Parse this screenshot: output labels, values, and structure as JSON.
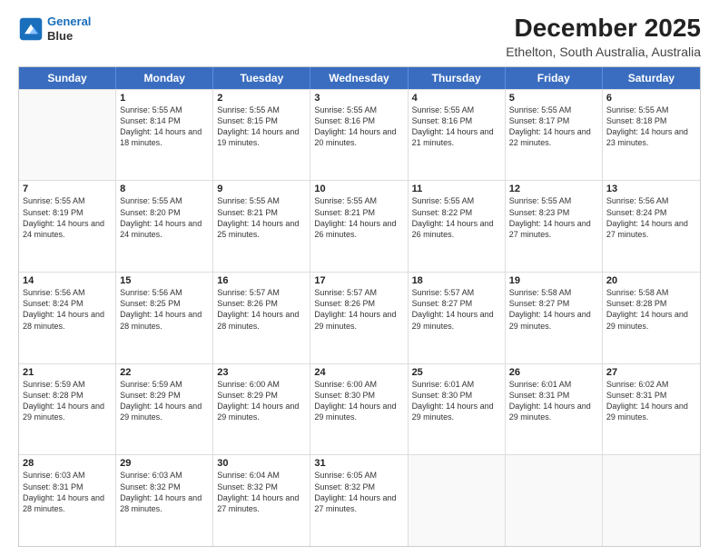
{
  "header": {
    "logo_line1": "General",
    "logo_line2": "Blue",
    "main_title": "December 2025",
    "sub_title": "Ethelton, South Australia, Australia"
  },
  "days_of_week": [
    "Sunday",
    "Monday",
    "Tuesday",
    "Wednesday",
    "Thursday",
    "Friday",
    "Saturday"
  ],
  "weeks": [
    [
      {
        "day": "",
        "sunrise": "",
        "sunset": "",
        "daylight": ""
      },
      {
        "day": "1",
        "sunrise": "Sunrise: 5:55 AM",
        "sunset": "Sunset: 8:14 PM",
        "daylight": "Daylight: 14 hours and 18 minutes."
      },
      {
        "day": "2",
        "sunrise": "Sunrise: 5:55 AM",
        "sunset": "Sunset: 8:15 PM",
        "daylight": "Daylight: 14 hours and 19 minutes."
      },
      {
        "day": "3",
        "sunrise": "Sunrise: 5:55 AM",
        "sunset": "Sunset: 8:16 PM",
        "daylight": "Daylight: 14 hours and 20 minutes."
      },
      {
        "day": "4",
        "sunrise": "Sunrise: 5:55 AM",
        "sunset": "Sunset: 8:16 PM",
        "daylight": "Daylight: 14 hours and 21 minutes."
      },
      {
        "day": "5",
        "sunrise": "Sunrise: 5:55 AM",
        "sunset": "Sunset: 8:17 PM",
        "daylight": "Daylight: 14 hours and 22 minutes."
      },
      {
        "day": "6",
        "sunrise": "Sunrise: 5:55 AM",
        "sunset": "Sunset: 8:18 PM",
        "daylight": "Daylight: 14 hours and 23 minutes."
      }
    ],
    [
      {
        "day": "7",
        "sunrise": "Sunrise: 5:55 AM",
        "sunset": "Sunset: 8:19 PM",
        "daylight": "Daylight: 14 hours and 24 minutes."
      },
      {
        "day": "8",
        "sunrise": "Sunrise: 5:55 AM",
        "sunset": "Sunset: 8:20 PM",
        "daylight": "Daylight: 14 hours and 24 minutes."
      },
      {
        "day": "9",
        "sunrise": "Sunrise: 5:55 AM",
        "sunset": "Sunset: 8:21 PM",
        "daylight": "Daylight: 14 hours and 25 minutes."
      },
      {
        "day": "10",
        "sunrise": "Sunrise: 5:55 AM",
        "sunset": "Sunset: 8:21 PM",
        "daylight": "Daylight: 14 hours and 26 minutes."
      },
      {
        "day": "11",
        "sunrise": "Sunrise: 5:55 AM",
        "sunset": "Sunset: 8:22 PM",
        "daylight": "Daylight: 14 hours and 26 minutes."
      },
      {
        "day": "12",
        "sunrise": "Sunrise: 5:55 AM",
        "sunset": "Sunset: 8:23 PM",
        "daylight": "Daylight: 14 hours and 27 minutes."
      },
      {
        "day": "13",
        "sunrise": "Sunrise: 5:56 AM",
        "sunset": "Sunset: 8:24 PM",
        "daylight": "Daylight: 14 hours and 27 minutes."
      }
    ],
    [
      {
        "day": "14",
        "sunrise": "Sunrise: 5:56 AM",
        "sunset": "Sunset: 8:24 PM",
        "daylight": "Daylight: 14 hours and 28 minutes."
      },
      {
        "day": "15",
        "sunrise": "Sunrise: 5:56 AM",
        "sunset": "Sunset: 8:25 PM",
        "daylight": "Daylight: 14 hours and 28 minutes."
      },
      {
        "day": "16",
        "sunrise": "Sunrise: 5:57 AM",
        "sunset": "Sunset: 8:26 PM",
        "daylight": "Daylight: 14 hours and 28 minutes."
      },
      {
        "day": "17",
        "sunrise": "Sunrise: 5:57 AM",
        "sunset": "Sunset: 8:26 PM",
        "daylight": "Daylight: 14 hours and 29 minutes."
      },
      {
        "day": "18",
        "sunrise": "Sunrise: 5:57 AM",
        "sunset": "Sunset: 8:27 PM",
        "daylight": "Daylight: 14 hours and 29 minutes."
      },
      {
        "day": "19",
        "sunrise": "Sunrise: 5:58 AM",
        "sunset": "Sunset: 8:27 PM",
        "daylight": "Daylight: 14 hours and 29 minutes."
      },
      {
        "day": "20",
        "sunrise": "Sunrise: 5:58 AM",
        "sunset": "Sunset: 8:28 PM",
        "daylight": "Daylight: 14 hours and 29 minutes."
      }
    ],
    [
      {
        "day": "21",
        "sunrise": "Sunrise: 5:59 AM",
        "sunset": "Sunset: 8:28 PM",
        "daylight": "Daylight: 14 hours and 29 minutes."
      },
      {
        "day": "22",
        "sunrise": "Sunrise: 5:59 AM",
        "sunset": "Sunset: 8:29 PM",
        "daylight": "Daylight: 14 hours and 29 minutes."
      },
      {
        "day": "23",
        "sunrise": "Sunrise: 6:00 AM",
        "sunset": "Sunset: 8:29 PM",
        "daylight": "Daylight: 14 hours and 29 minutes."
      },
      {
        "day": "24",
        "sunrise": "Sunrise: 6:00 AM",
        "sunset": "Sunset: 8:30 PM",
        "daylight": "Daylight: 14 hours and 29 minutes."
      },
      {
        "day": "25",
        "sunrise": "Sunrise: 6:01 AM",
        "sunset": "Sunset: 8:30 PM",
        "daylight": "Daylight: 14 hours and 29 minutes."
      },
      {
        "day": "26",
        "sunrise": "Sunrise: 6:01 AM",
        "sunset": "Sunset: 8:31 PM",
        "daylight": "Daylight: 14 hours and 29 minutes."
      },
      {
        "day": "27",
        "sunrise": "Sunrise: 6:02 AM",
        "sunset": "Sunset: 8:31 PM",
        "daylight": "Daylight: 14 hours and 29 minutes."
      }
    ],
    [
      {
        "day": "28",
        "sunrise": "Sunrise: 6:03 AM",
        "sunset": "Sunset: 8:31 PM",
        "daylight": "Daylight: 14 hours and 28 minutes."
      },
      {
        "day": "29",
        "sunrise": "Sunrise: 6:03 AM",
        "sunset": "Sunset: 8:32 PM",
        "daylight": "Daylight: 14 hours and 28 minutes."
      },
      {
        "day": "30",
        "sunrise": "Sunrise: 6:04 AM",
        "sunset": "Sunset: 8:32 PM",
        "daylight": "Daylight: 14 hours and 27 minutes."
      },
      {
        "day": "31",
        "sunrise": "Sunrise: 6:05 AM",
        "sunset": "Sunset: 8:32 PM",
        "daylight": "Daylight: 14 hours and 27 minutes."
      },
      {
        "day": "",
        "sunrise": "",
        "sunset": "",
        "daylight": ""
      },
      {
        "day": "",
        "sunrise": "",
        "sunset": "",
        "daylight": ""
      },
      {
        "day": "",
        "sunrise": "",
        "sunset": "",
        "daylight": ""
      }
    ]
  ]
}
